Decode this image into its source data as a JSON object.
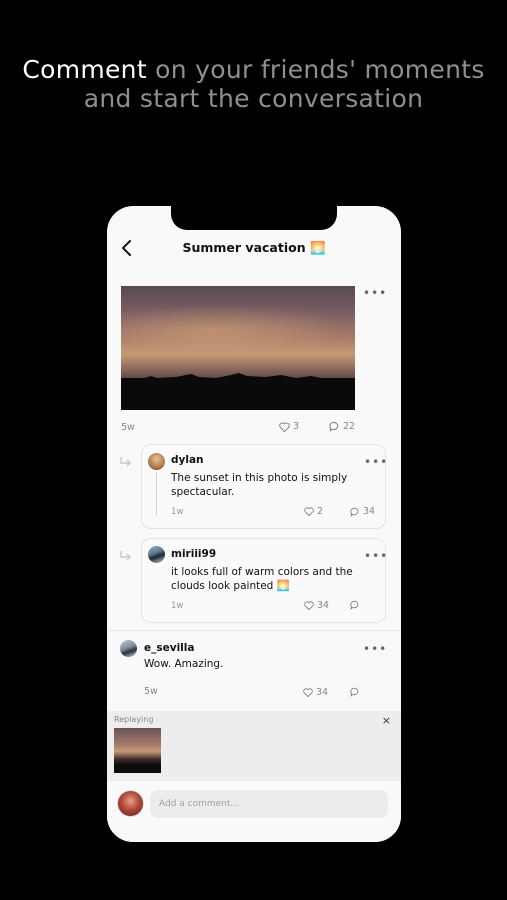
{
  "headline": {
    "strong": "Comment",
    "rest": " on your friends' moments and start the conversation"
  },
  "screen": {
    "title": "Summer vacation 🌅"
  },
  "post": {
    "age": "5w",
    "likes": "3",
    "comments": "22"
  },
  "comments": [
    {
      "user": "dylan",
      "text": "The sunset in this photo is simply spectacular.",
      "age": "1w",
      "likes": "2",
      "replies": "34"
    },
    {
      "user": "miriii99",
      "text": "it looks full of warm colors and the clouds look painted 🌅",
      "age": "1w",
      "likes": "34",
      "replies": ""
    },
    {
      "user": "e_sevilla",
      "text": "Wow. Amazing.",
      "age": "5w",
      "likes": "34",
      "replies": ""
    }
  ],
  "reply_panel": {
    "label": "Replaying",
    "close": "×"
  },
  "composer": {
    "placeholder": "Add a comment..."
  },
  "icons": {
    "back": "chevron-left-icon",
    "more": "more-horizontal-icon",
    "like": "heart-icon",
    "comment": "comment-bubble-icon",
    "reply": "reply-arrow-icon",
    "close": "close-icon"
  },
  "colors": {
    "background": "#000000",
    "headline_muted": "#8f8f8f",
    "phone_bg": "#f9f9f9"
  }
}
